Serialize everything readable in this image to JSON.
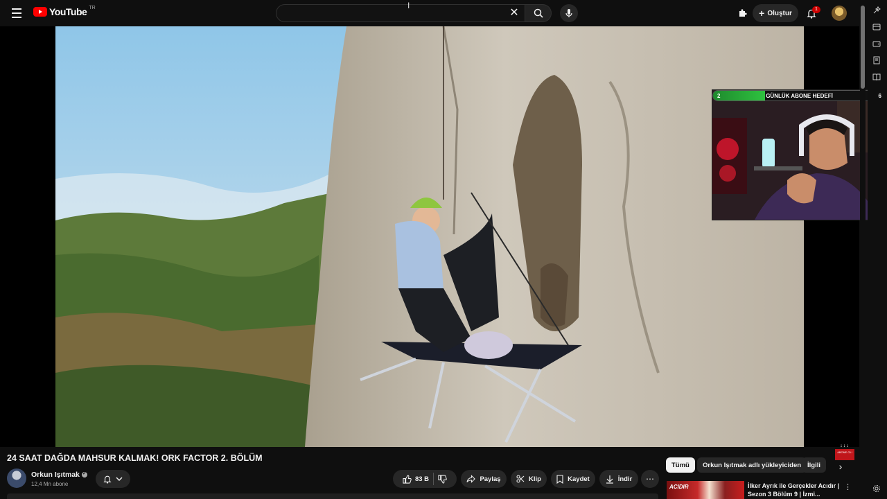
{
  "header": {
    "logo_text": "YouTube",
    "region": "TR",
    "search_placeholder": "",
    "create_label": "Oluştur",
    "notification_count": "1"
  },
  "player": {
    "overlay": {
      "goal_start": "2",
      "goal_label": "GÜNLÜK ABONE HEDEFİ",
      "goal_end": "6",
      "goal_progress": 0.3
    },
    "abone_badge_arrows": "↓↓↓",
    "abone_badge_text": "ABONE OL!"
  },
  "video": {
    "title": "24 SAAT DAĞDA MAHSUR KALMAK! ORK FACTOR 2. BÖLÜM",
    "channel_name": "Orkun Işıtmak",
    "subscribers": "12,4 Mn abone",
    "like_count": "83 B",
    "share_label": "Paylaş",
    "clip_label": "Klip",
    "save_label": "Kaydet",
    "download_label": "İndir"
  },
  "sidebar": {
    "chips": [
      "Tümü",
      "Orkun Işıtmak adlı yükleyiciden",
      "İlgili"
    ],
    "recommendation": {
      "thumb_text": "ACIDIR",
      "title": "İlker Ayrık ile Gerçekler Acıdır | Sezon 3 Bölüm 9 | İzmi..."
    }
  },
  "colors": {
    "background": "#0f0f0f",
    "brand_red": "#ff0000",
    "goal_green": "#2ec23f",
    "chip_active": "#f1f1f1"
  }
}
